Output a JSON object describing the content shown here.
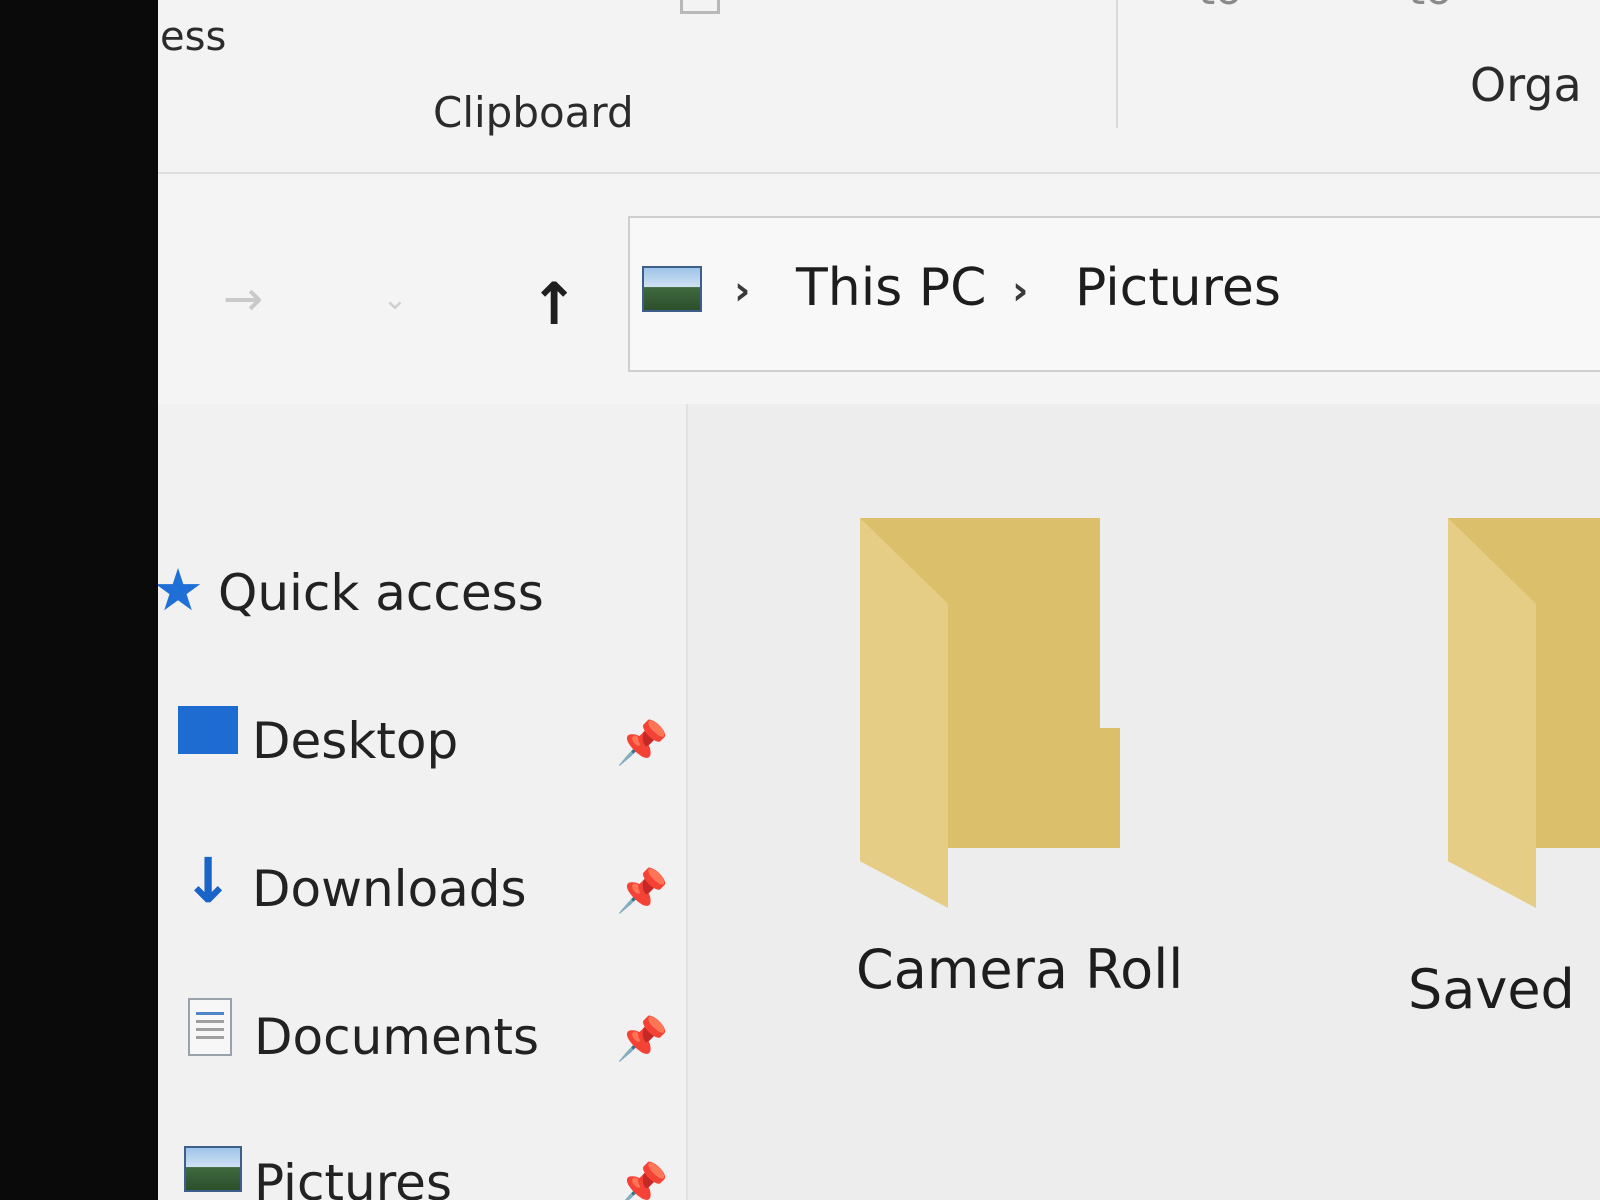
{
  "ribbon": {
    "cut_text": "ess",
    "group_clipboard": "Clipboard",
    "group_organize": "Orga",
    "top_fragment_1": "to",
    "top_fragment_2": "to"
  },
  "nav": {
    "forward_glyph": "→",
    "history_glyph": "⌄",
    "up_glyph": "↑",
    "breadcrumb_sep": "›",
    "crumbs": [
      "This PC",
      "Pictures"
    ]
  },
  "sidebar": {
    "items": [
      {
        "label": "Quick access",
        "icon": "star-icon"
      },
      {
        "label": "Desktop",
        "icon": "desktop-folder-icon",
        "pinned": true
      },
      {
        "label": "Downloads",
        "icon": "download-arrow-icon",
        "pinned": true
      },
      {
        "label": "Documents",
        "icon": "document-icon",
        "pinned": true
      },
      {
        "label": "Pictures",
        "icon": "pictures-icon",
        "pinned": true
      }
    ],
    "star_glyph": "★",
    "download_glyph": "↓",
    "pin_glyph": "📌"
  },
  "content": {
    "folders": [
      {
        "label": "Camera Roll",
        "icon": "folder-icon"
      },
      {
        "label": "Saved",
        "icon": "folder-icon"
      }
    ]
  },
  "colors": {
    "accent": "#1f6fd6",
    "folder": "#dcbf6a",
    "background": "#f0f0f0"
  }
}
